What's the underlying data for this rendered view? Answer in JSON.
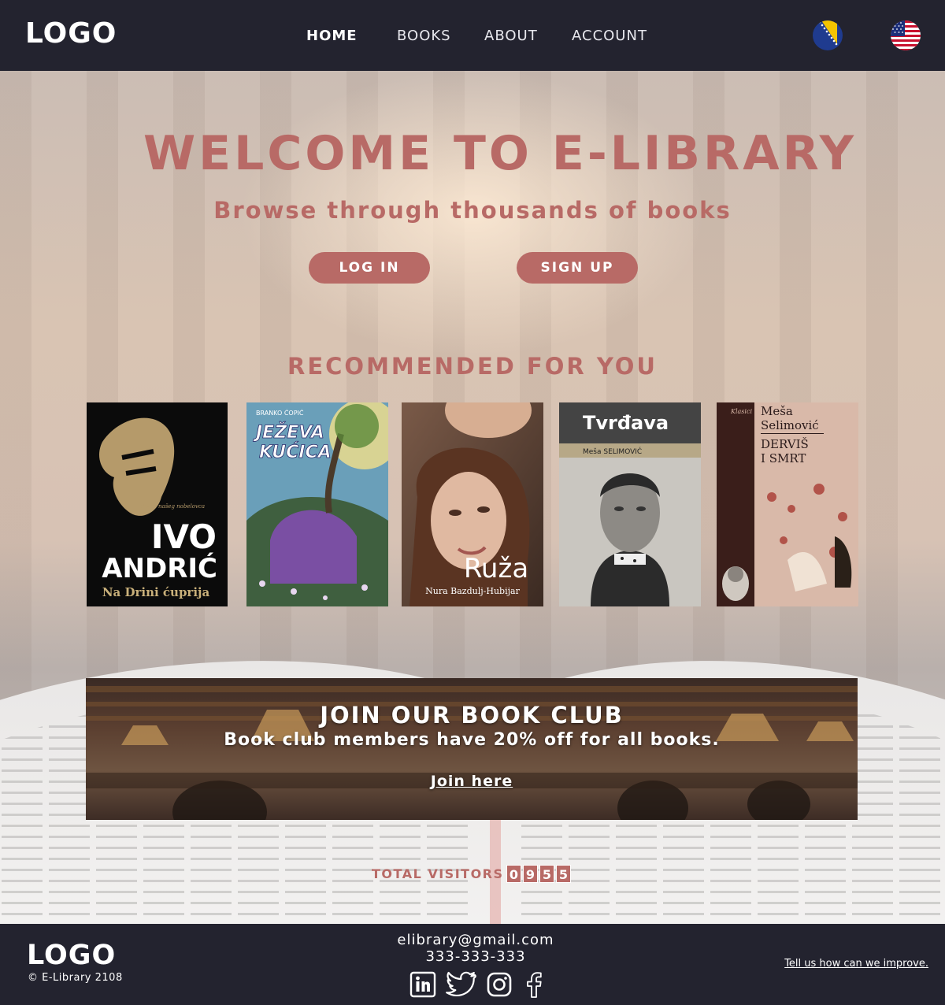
{
  "header": {
    "logo": "LOGO",
    "nav": [
      "HOME",
      "BOOKS",
      "ABOUT",
      "ACCOUNT"
    ],
    "active_nav": "HOME",
    "flags": [
      "bosnia-flag-icon",
      "usa-flag-icon"
    ]
  },
  "hero": {
    "title": "WELCOME TO E-LIBRARY",
    "subtitle": "Browse through thousands of books",
    "login_label": "LOG IN",
    "signup_label": "SIGN UP"
  },
  "recommended": {
    "title": "RECOMMENDED FOR YOU",
    "books": [
      {
        "top_text": "Biseri našeg nobelovca",
        "author": "IVO ANDRIĆ",
        "title": "Na Drini ćuprija"
      },
      {
        "author": "BRANKO ĆOPIĆ",
        "title": "JEŽEVA KUĆICA"
      },
      {
        "title": "Ruža",
        "author": "Nura Bazdulj-Hubijar"
      },
      {
        "title": "Tvrđava",
        "author": "Meša SELIMOVIĆ"
      },
      {
        "series": "Klasici",
        "author": "Meša Selimović",
        "title": "DERVIŠ I SMRT"
      }
    ]
  },
  "club": {
    "title": "JOIN OUR BOOK CLUB",
    "subtitle": "Book club members have 20% off for all books.",
    "link": "Join here"
  },
  "visitors": {
    "label": "TOTAL VISITORS",
    "digits": [
      "0",
      "9",
      "5",
      "5"
    ]
  },
  "footer": {
    "logo": "LOGO",
    "copyright": "© E-Library 2108",
    "email": "elibrary@gmail.com",
    "phone": "333-333-333",
    "social": [
      "linkedin-icon",
      "twitter-icon",
      "instagram-icon",
      "facebook-icon"
    ],
    "improve_link": "Tell us how can we improve."
  },
  "colors": {
    "accent": "#b86a66",
    "dark": "#23232f"
  }
}
